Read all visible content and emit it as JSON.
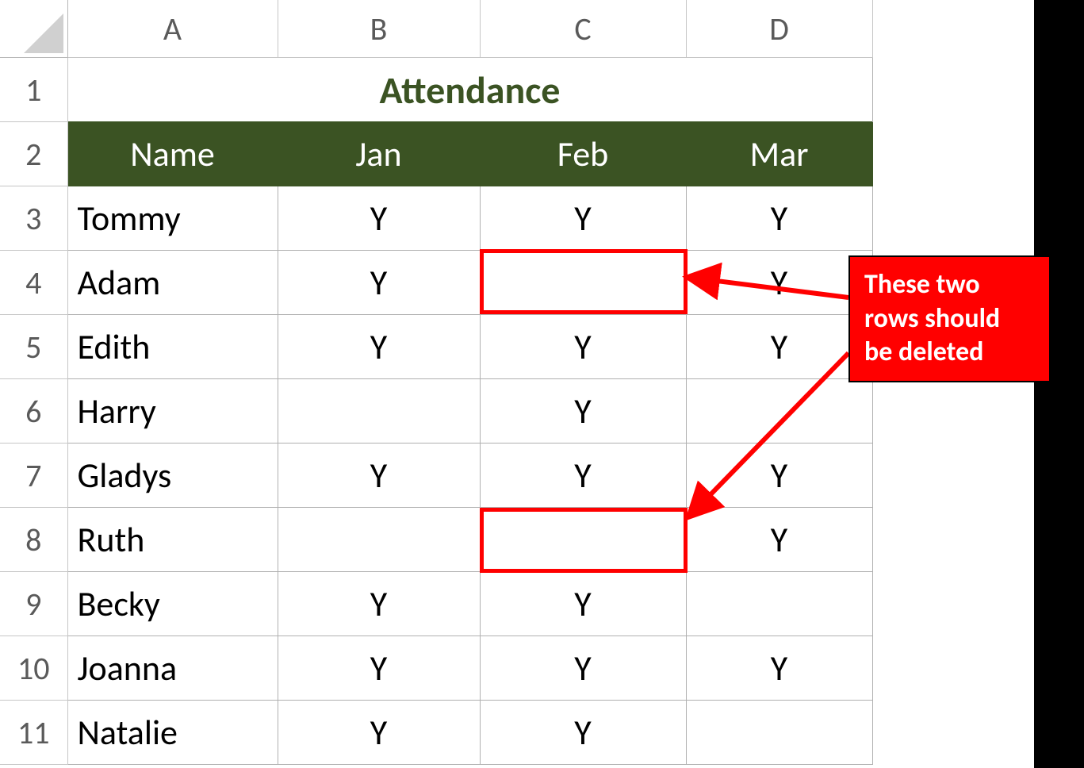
{
  "columns": {
    "A": "A",
    "B": "B",
    "C": "C",
    "D": "D"
  },
  "rownums": [
    "1",
    "2",
    "3",
    "4",
    "5",
    "6",
    "7",
    "8",
    "9",
    "10",
    "11"
  ],
  "title": "Attendance",
  "headers": {
    "name": "Name",
    "jan": "Jan",
    "feb": "Feb",
    "mar": "Mar"
  },
  "rows": [
    {
      "name": "Tommy",
      "jan": "Y",
      "feb": "Y",
      "mar": "Y"
    },
    {
      "name": "Adam",
      "jan": "Y",
      "feb": "",
      "mar": "Y"
    },
    {
      "name": "Edith",
      "jan": "Y",
      "feb": "Y",
      "mar": "Y"
    },
    {
      "name": "Harry",
      "jan": "",
      "feb": "Y",
      "mar": ""
    },
    {
      "name": "Gladys",
      "jan": "Y",
      "feb": "Y",
      "mar": "Y"
    },
    {
      "name": "Ruth",
      "jan": "",
      "feb": "",
      "mar": "Y"
    },
    {
      "name": "Becky",
      "jan": "Y",
      "feb": "Y",
      "mar": ""
    },
    {
      "name": "Joanna",
      "jan": "Y",
      "feb": "Y",
      "mar": "Y"
    },
    {
      "name": "Natalie",
      "jan": "Y",
      "feb": "Y",
      "mar": ""
    }
  ],
  "callout": {
    "line1": "These two",
    "line2": "rows should",
    "line3": "be deleted"
  },
  "colors": {
    "headerFill": "#3b5323",
    "titleText": "#3b5323",
    "highlight": "#ff0000"
  }
}
